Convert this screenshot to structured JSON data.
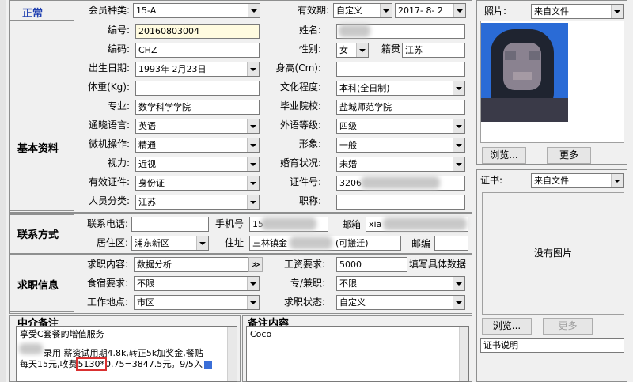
{
  "header": {
    "status": "正常",
    "member_type_label": "会员种类:",
    "member_type_value": "15-A",
    "validity_label": "有效期:",
    "validity_mode": "自定义",
    "validity_date": "2017- 8- 2"
  },
  "basic": {
    "section_title": "基本资料",
    "number_label": "编号:",
    "number_value": "20160803004",
    "name_label": "姓名:",
    "code_label": "编码:",
    "code_value": "CHZ",
    "gender_label": "性别:",
    "gender_value": "女",
    "native_label": "籍贯",
    "native_value": "江苏",
    "birth_label": "出生日期:",
    "birth_value": "1993年 2月23日",
    "height_label": "身高(Cm):",
    "weight_label": "体重(Kg):",
    "education_label": "文化程度:",
    "education_value": "本科(全日制)",
    "major_label": "专业:",
    "major_value": "数学科学学院",
    "school_label": "毕业院校:",
    "school_value": "盐城师范学院",
    "language_label": "通晓语言:",
    "language_value": "英语",
    "foreign_level_label": "外语等级:",
    "foreign_level_value": "四级",
    "computer_label": "微机操作:",
    "computer_value": "精通",
    "appearance_label": "形象:",
    "appearance_value": "一般",
    "vision_label": "视力:",
    "vision_value": "近视",
    "marital_label": "婚育状况:",
    "marital_value": "未婚",
    "id_type_label": "有效证件:",
    "id_type_value": "身份证",
    "id_number_label": "证件号:",
    "id_number_value": "3206",
    "category_label": "人员分类:",
    "category_value": "江苏",
    "title_label": "职称:"
  },
  "contact": {
    "section_title": "联系方式",
    "phone_label": "联系电话:",
    "mobile_label": "手机号",
    "mobile_value": "15",
    "email_label": "邮箱",
    "email_value": "xia",
    "district_label": "居住区:",
    "district_value": "浦东新区",
    "address_label": "住址",
    "address_value_prefix": "三林镇金",
    "address_value_suffix": "(可搬迁)",
    "postcode_label": "邮编"
  },
  "jobseek": {
    "section_title": "求职信息",
    "content_label": "求职内容:",
    "content_value": "数据分析",
    "more_button": "≫",
    "salary_label": "工资要求:",
    "salary_value": "5000",
    "salary_hint": "填写具体数据",
    "meal_label": "食宿要求:",
    "meal_value": "不限",
    "fulltime_label": "专/兼职:",
    "fulltime_value": "不限",
    "location_label": "工作地点:",
    "location_value": "市区",
    "job_status_label": "求职状态:",
    "job_status_value": "自定义"
  },
  "notes": {
    "agency_title": "中介备注",
    "agency_line1": "享受C套餐的增值服务",
    "agency_line2_suffix": "录用 薪资试用期4.8k,转正5k加奖金,餐贴",
    "agency_line3_prefix": "每天15元,收费",
    "agency_line3_boxed": "5130*",
    "agency_line3_suffix": "0.75=3847.5元。9/5入",
    "remark_title": "备注内容",
    "remark_value": "Coco"
  },
  "photo": {
    "label": "照片:",
    "source": "来自文件",
    "browse_button": "浏览...",
    "more_button": "更多"
  },
  "certificate": {
    "label": "证书:",
    "source": "来自文件",
    "no_image": "没有图片",
    "browse_button": "浏览...",
    "more_button": "更多",
    "description_value": "证书说明"
  }
}
